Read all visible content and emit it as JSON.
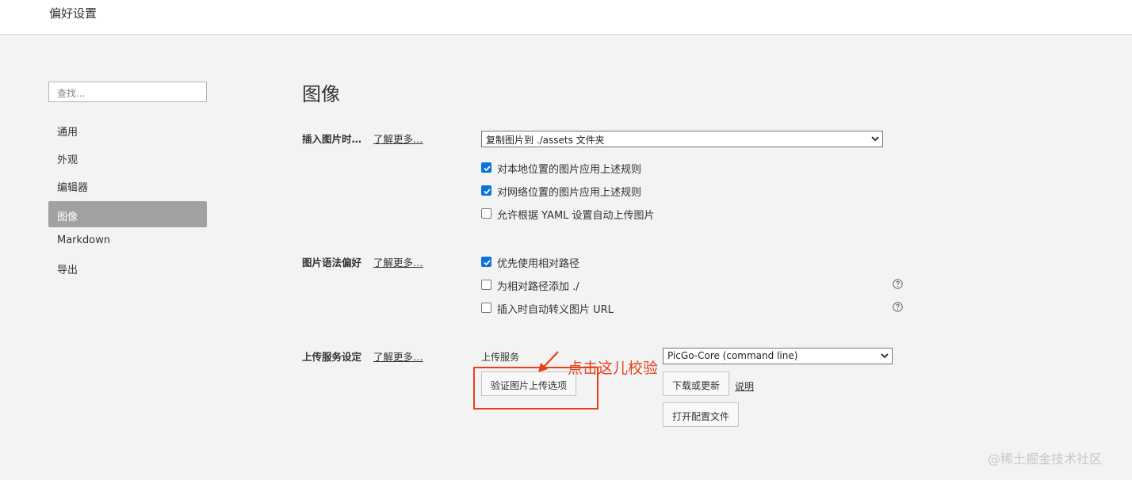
{
  "window": {
    "title": "偏好设置"
  },
  "sidebar": {
    "search_placeholder": "查找...",
    "items": [
      {
        "label": "通用",
        "active": false
      },
      {
        "label": "外观",
        "active": false
      },
      {
        "label": "编辑器",
        "active": false
      },
      {
        "label": "图像",
        "active": true
      },
      {
        "label": "Markdown",
        "active": false
      },
      {
        "label": "导出",
        "active": false
      }
    ]
  },
  "main": {
    "heading": "图像",
    "insert_section": {
      "label": "插入图片时…",
      "learn_more": "了解更多…",
      "select_value": "复制图片到 ./assets 文件夹",
      "options": [
        {
          "label": "对本地位置的图片应用上述规则",
          "checked": true
        },
        {
          "label": "对网络位置的图片应用上述规则",
          "checked": true
        },
        {
          "label": "允许根据 YAML 设置自动上传图片",
          "checked": false
        }
      ]
    },
    "syntax_section": {
      "label": "图片语法偏好",
      "learn_more": "了解更多…",
      "options": [
        {
          "label": "优先使用相对路径",
          "checked": true,
          "help": false
        },
        {
          "label": "为相对路径添加 ./",
          "checked": false,
          "help": true
        },
        {
          "label": "插入时自动转义图片 URL",
          "checked": false,
          "help": true
        }
      ]
    },
    "upload_section": {
      "label": "上传服务设定",
      "learn_more": "了解更多…",
      "service_label": "上传服务",
      "service_value": "PicGo-Core (command line)",
      "verify_button": "验证图片上传选项",
      "download_button": "下载或更新",
      "explain_link": "说明",
      "open_config_button": "打开配置文件"
    }
  },
  "annotation": {
    "text": "点击这儿校验",
    "color": "#e8401c"
  },
  "watermark": "@稀土掘金技术社区",
  "colors": {
    "checkbox_blue": "#0b74d9",
    "active_nav": "#a1a1a1"
  }
}
